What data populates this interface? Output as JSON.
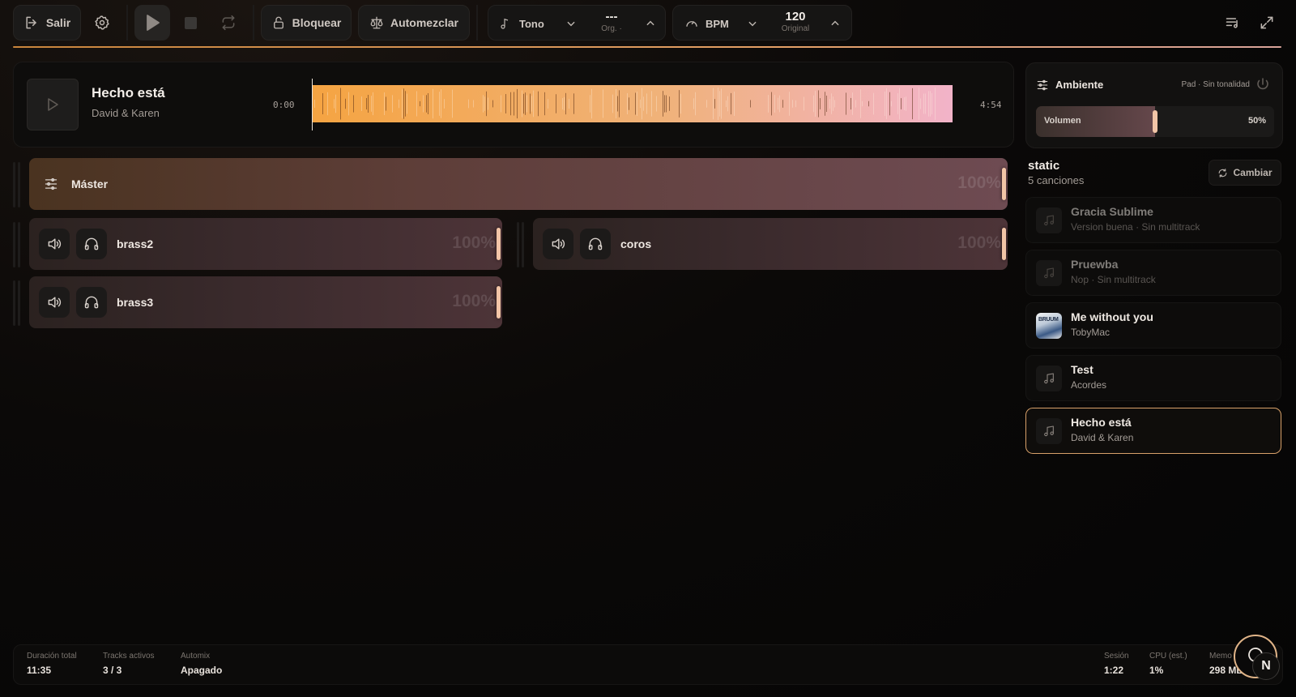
{
  "toolbar": {
    "exit_label": "Salir",
    "lock_label": "Bloquear",
    "automix_label": "Automezclar",
    "key_label": "Tono",
    "key_value": "---",
    "key_sub": "Org. ·",
    "bpm_label": "BPM",
    "bpm_value": "120",
    "bpm_sub": "Original"
  },
  "player": {
    "title": "Hecho está",
    "artist": "David & Karen",
    "time_current": "0:00",
    "time_total": "4:54"
  },
  "tracks": {
    "master": {
      "name": "Máster",
      "level": "100%"
    },
    "items": [
      {
        "name": "brass2",
        "level": "100%"
      },
      {
        "name": "coros",
        "level": "100%"
      },
      {
        "name": "brass3",
        "level": "100%"
      }
    ]
  },
  "ambient": {
    "title": "Ambiente",
    "subtitle": "Pad · Sin tonalidad",
    "volume_label": "Volumen",
    "volume_value": "50%",
    "volume_fraction": 0.5
  },
  "setlist": {
    "name": "static",
    "count": "5 canciones",
    "change_label": "Cambiar",
    "songs": [
      {
        "title": "Gracia Sublime",
        "subtitle": "Version buena · Sin multitrack"
      },
      {
        "title": "Pruewba",
        "subtitle": "Nop · Sin multitrack"
      },
      {
        "title": "Me without you",
        "subtitle": "TobyMac",
        "art_text": "BRUUM"
      },
      {
        "title": "Test",
        "subtitle": "Acordes"
      },
      {
        "title": "Hecho está",
        "subtitle": "David & Karen"
      }
    ]
  },
  "footer": {
    "duration_label": "Duración total",
    "duration_value": "11:35",
    "tracks_label": "Tracks activos",
    "tracks_value": "3 / 3",
    "automix_label": "Automix",
    "automix_value": "Apagado",
    "session_label": "Sesión",
    "session_value": "1:22",
    "cpu_label": "CPU (est.)",
    "cpu_value": "1%",
    "memory_label": "Memo",
    "memory_value": "298 MB"
  },
  "fab": {
    "letter": "N"
  },
  "colors": {
    "accent": "#e4a066",
    "handle": "#f2c5a7",
    "wave_start": "#f5a442",
    "wave_end": "#f2b3c9"
  }
}
